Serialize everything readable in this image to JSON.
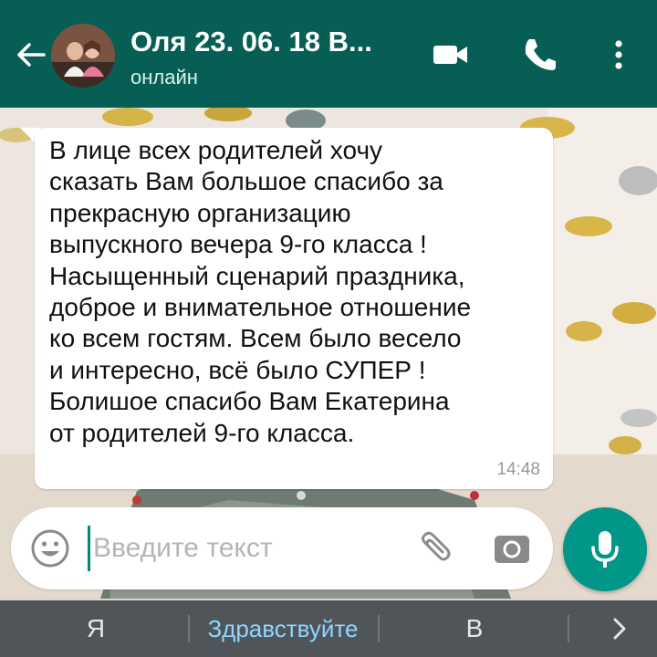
{
  "header": {
    "title": "Оля 23. 06. 18 В...",
    "status": "онлайн",
    "icons": [
      "back-arrow-icon",
      "avatar",
      "video-call-icon",
      "phone-icon",
      "more-vert-icon"
    ],
    "color": "#075e54"
  },
  "message": {
    "lines": [
      "В лице всех родителей хочу",
      "сказать Вам большое спасибо за",
      "прекрасную организацию",
      "выпускного вечера 9-го класса !",
      "Насыщенный сценарий праздника,",
      "доброе и внимательное отношение",
      "ко всем гостям. Всем было весело",
      "и интересно, всё было СУПЕР !",
      "Болишое спасибо Вам Екатерина",
      "от родителей 9-го класса."
    ],
    "time": "14:48"
  },
  "composer": {
    "placeholder": "Введите текст",
    "value": "",
    "icons": [
      "emoji-icon",
      "attach-icon",
      "camera-icon",
      "mic-icon"
    ],
    "accent": "#009688"
  },
  "keyboard": {
    "suggestions": [
      "Я",
      "Здравствуйте",
      "В"
    ],
    "expand_icon": "chevron-right-icon"
  }
}
